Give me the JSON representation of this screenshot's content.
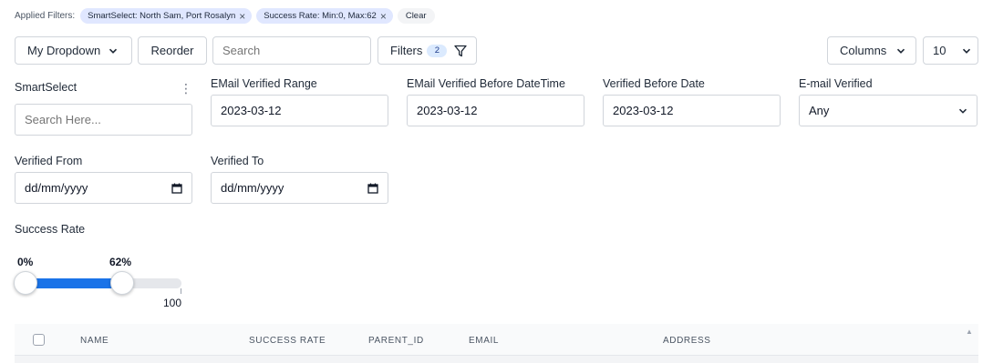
{
  "applied_filters": {
    "label": "Applied Filters:",
    "chips": [
      {
        "text": "SmartSelect: North Sam, Port Rosalyn",
        "remove": "×"
      },
      {
        "text": "Success Rate: Min:0, Max:62",
        "remove": "×"
      }
    ],
    "clear_label": "Clear"
  },
  "toolbar": {
    "dropdown_label": "My Dropdown",
    "reorder_label": "Reorder",
    "search_placeholder": "Search",
    "filters_label": "Filters",
    "filters_count": "2",
    "columns_label": "Columns",
    "page_size": "10"
  },
  "filters": {
    "smartselect": {
      "label": "SmartSelect",
      "placeholder": "Search Here...",
      "menu": "⋮"
    },
    "email_verified_range": {
      "label": "EMail Verified Range",
      "value": "2023-03-12"
    },
    "email_verified_before_datetime": {
      "label": "EMail Verified Before DateTime",
      "value": "2023-03-12"
    },
    "verified_before_date": {
      "label": "Verified Before Date",
      "value": "2023-03-12"
    },
    "email_verified": {
      "label": "E-mail Verified",
      "value": "Any"
    },
    "verified_from": {
      "label": "Verified From",
      "value": "dd/mm/yyyy"
    },
    "verified_to": {
      "label": "Verified To",
      "value": "dd/mm/yyyy"
    },
    "success_rate": {
      "label": "Success Rate",
      "min_label": "0%",
      "max_label": "62%",
      "min": 0,
      "max": 62,
      "range_max": 100,
      "range_max_label": "100"
    }
  },
  "table": {
    "columns": [
      "NAME",
      "SUCCESS RATE",
      "PARENT_ID",
      "EMAIL",
      "ADDRESS"
    ],
    "scroll_up": "▲"
  },
  "colors": {
    "accent": "#1a73e8",
    "chip_bg": "#e0e7ff"
  }
}
